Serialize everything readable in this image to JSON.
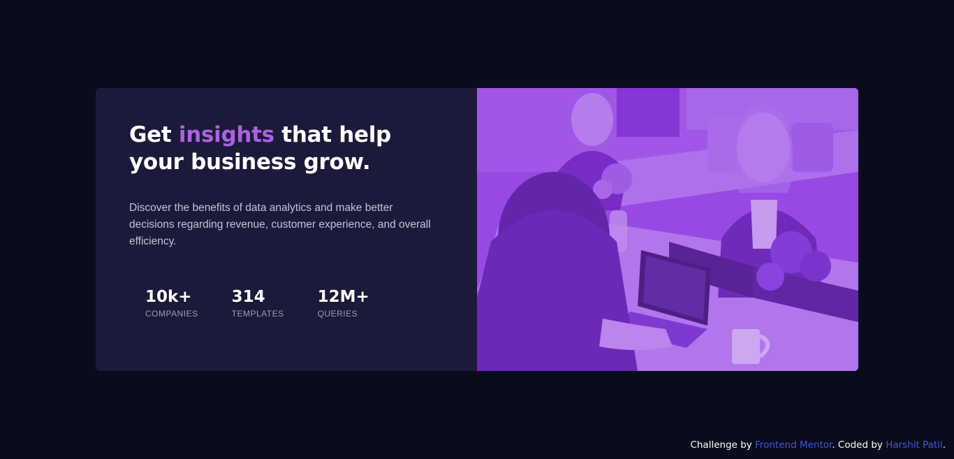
{
  "hero": {
    "headline_before": "Get",
    "headline_accent": "insights",
    "headline_after": "that help your business grow.",
    "description": "Discover the benefits of data analytics and make better decisions regarding revenue, customer experience, and overall efficiency."
  },
  "stats": [
    {
      "value": "10k+",
      "label": "COMPANIES"
    },
    {
      "value": "314",
      "label": "TEMPLATES"
    },
    {
      "value": "12M+",
      "label": "QUERIES"
    }
  ],
  "footer": {
    "challenge_text": "Challenge by",
    "frontend_mentor_link": "Frontend Mentor",
    "coded_text": ". Coded by",
    "author_link": "Harshit Patil",
    "end": "."
  },
  "colors": {
    "page_background": "#0a0c1b",
    "card_background": "#1c1a3b",
    "accent": "#a963de",
    "image_overlay": "#8e3fe0",
    "link": "#4654d8"
  }
}
